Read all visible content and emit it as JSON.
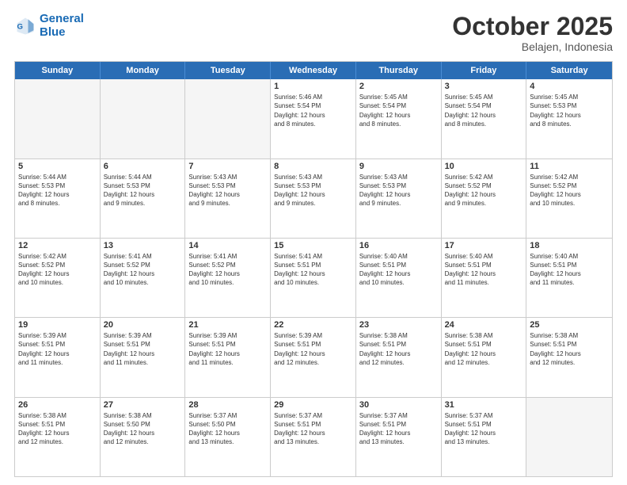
{
  "header": {
    "logo_line1": "General",
    "logo_line2": "Blue",
    "month": "October 2025",
    "location": "Belajen, Indonesia"
  },
  "days_of_week": [
    "Sunday",
    "Monday",
    "Tuesday",
    "Wednesday",
    "Thursday",
    "Friday",
    "Saturday"
  ],
  "weeks": [
    [
      {
        "day": "",
        "info": ""
      },
      {
        "day": "",
        "info": ""
      },
      {
        "day": "",
        "info": ""
      },
      {
        "day": "1",
        "info": "Sunrise: 5:46 AM\nSunset: 5:54 PM\nDaylight: 12 hours\nand 8 minutes."
      },
      {
        "day": "2",
        "info": "Sunrise: 5:45 AM\nSunset: 5:54 PM\nDaylight: 12 hours\nand 8 minutes."
      },
      {
        "day": "3",
        "info": "Sunrise: 5:45 AM\nSunset: 5:54 PM\nDaylight: 12 hours\nand 8 minutes."
      },
      {
        "day": "4",
        "info": "Sunrise: 5:45 AM\nSunset: 5:53 PM\nDaylight: 12 hours\nand 8 minutes."
      }
    ],
    [
      {
        "day": "5",
        "info": "Sunrise: 5:44 AM\nSunset: 5:53 PM\nDaylight: 12 hours\nand 8 minutes."
      },
      {
        "day": "6",
        "info": "Sunrise: 5:44 AM\nSunset: 5:53 PM\nDaylight: 12 hours\nand 9 minutes."
      },
      {
        "day": "7",
        "info": "Sunrise: 5:43 AM\nSunset: 5:53 PM\nDaylight: 12 hours\nand 9 minutes."
      },
      {
        "day": "8",
        "info": "Sunrise: 5:43 AM\nSunset: 5:53 PM\nDaylight: 12 hours\nand 9 minutes."
      },
      {
        "day": "9",
        "info": "Sunrise: 5:43 AM\nSunset: 5:53 PM\nDaylight: 12 hours\nand 9 minutes."
      },
      {
        "day": "10",
        "info": "Sunrise: 5:42 AM\nSunset: 5:52 PM\nDaylight: 12 hours\nand 9 minutes."
      },
      {
        "day": "11",
        "info": "Sunrise: 5:42 AM\nSunset: 5:52 PM\nDaylight: 12 hours\nand 10 minutes."
      }
    ],
    [
      {
        "day": "12",
        "info": "Sunrise: 5:42 AM\nSunset: 5:52 PM\nDaylight: 12 hours\nand 10 minutes."
      },
      {
        "day": "13",
        "info": "Sunrise: 5:41 AM\nSunset: 5:52 PM\nDaylight: 12 hours\nand 10 minutes."
      },
      {
        "day": "14",
        "info": "Sunrise: 5:41 AM\nSunset: 5:52 PM\nDaylight: 12 hours\nand 10 minutes."
      },
      {
        "day": "15",
        "info": "Sunrise: 5:41 AM\nSunset: 5:51 PM\nDaylight: 12 hours\nand 10 minutes."
      },
      {
        "day": "16",
        "info": "Sunrise: 5:40 AM\nSunset: 5:51 PM\nDaylight: 12 hours\nand 10 minutes."
      },
      {
        "day": "17",
        "info": "Sunrise: 5:40 AM\nSunset: 5:51 PM\nDaylight: 12 hours\nand 11 minutes."
      },
      {
        "day": "18",
        "info": "Sunrise: 5:40 AM\nSunset: 5:51 PM\nDaylight: 12 hours\nand 11 minutes."
      }
    ],
    [
      {
        "day": "19",
        "info": "Sunrise: 5:39 AM\nSunset: 5:51 PM\nDaylight: 12 hours\nand 11 minutes."
      },
      {
        "day": "20",
        "info": "Sunrise: 5:39 AM\nSunset: 5:51 PM\nDaylight: 12 hours\nand 11 minutes."
      },
      {
        "day": "21",
        "info": "Sunrise: 5:39 AM\nSunset: 5:51 PM\nDaylight: 12 hours\nand 11 minutes."
      },
      {
        "day": "22",
        "info": "Sunrise: 5:39 AM\nSunset: 5:51 PM\nDaylight: 12 hours\nand 12 minutes."
      },
      {
        "day": "23",
        "info": "Sunrise: 5:38 AM\nSunset: 5:51 PM\nDaylight: 12 hours\nand 12 minutes."
      },
      {
        "day": "24",
        "info": "Sunrise: 5:38 AM\nSunset: 5:51 PM\nDaylight: 12 hours\nand 12 minutes."
      },
      {
        "day": "25",
        "info": "Sunrise: 5:38 AM\nSunset: 5:51 PM\nDaylight: 12 hours\nand 12 minutes."
      }
    ],
    [
      {
        "day": "26",
        "info": "Sunrise: 5:38 AM\nSunset: 5:51 PM\nDaylight: 12 hours\nand 12 minutes."
      },
      {
        "day": "27",
        "info": "Sunrise: 5:38 AM\nSunset: 5:50 PM\nDaylight: 12 hours\nand 12 minutes."
      },
      {
        "day": "28",
        "info": "Sunrise: 5:37 AM\nSunset: 5:50 PM\nDaylight: 12 hours\nand 13 minutes."
      },
      {
        "day": "29",
        "info": "Sunrise: 5:37 AM\nSunset: 5:51 PM\nDaylight: 12 hours\nand 13 minutes."
      },
      {
        "day": "30",
        "info": "Sunrise: 5:37 AM\nSunset: 5:51 PM\nDaylight: 12 hours\nand 13 minutes."
      },
      {
        "day": "31",
        "info": "Sunrise: 5:37 AM\nSunset: 5:51 PM\nDaylight: 12 hours\nand 13 minutes."
      },
      {
        "day": "",
        "info": ""
      }
    ]
  ]
}
